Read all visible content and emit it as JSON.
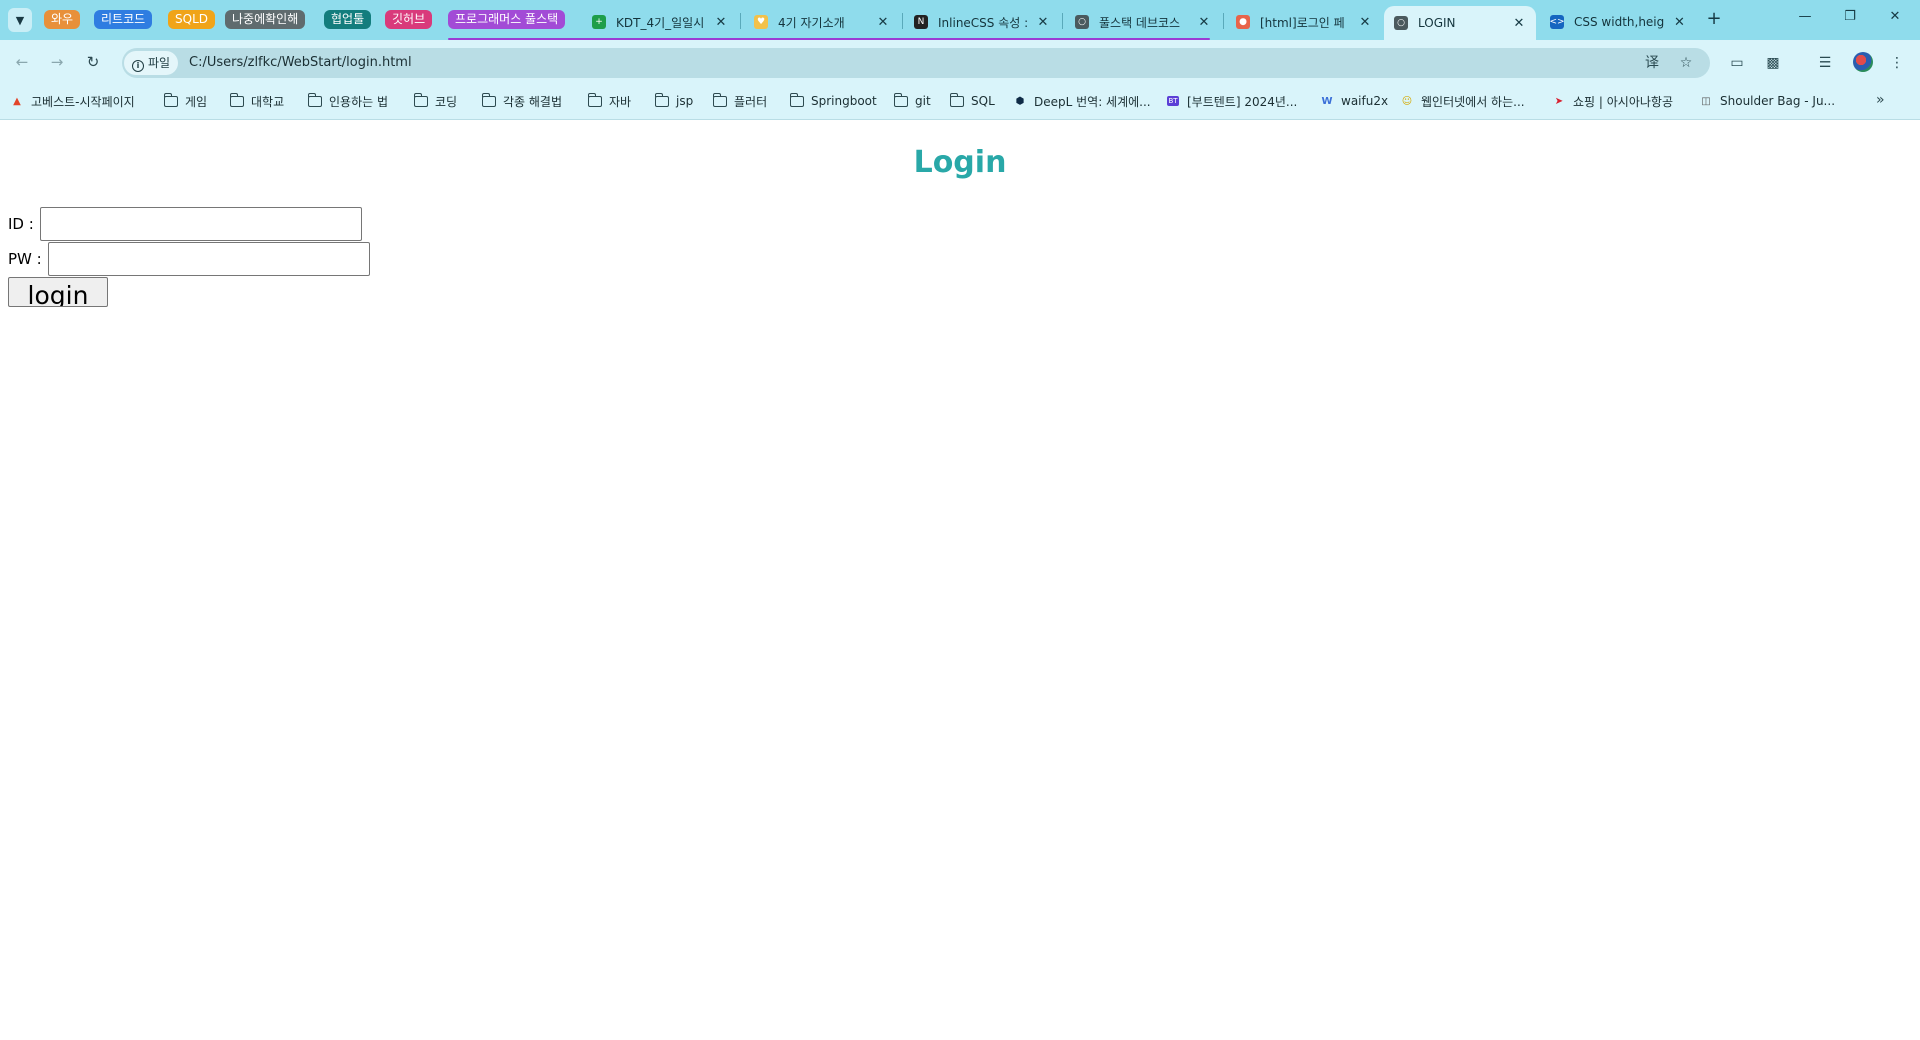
{
  "browser": {
    "tab_groups": [
      {
        "label": "와우",
        "color": "#e8903a"
      },
      {
        "label": "리트코드",
        "color": "#2f7de1"
      },
      {
        "label": "SQLD",
        "color": "#f0a418"
      },
      {
        "label": "나중에확인해",
        "color": "#5f6b6e"
      },
      {
        "label": "협업툴",
        "color": "#137d7d"
      },
      {
        "label": "깃허브",
        "color": "#d93a7b"
      },
      {
        "label": "프로그래머스 풀스택",
        "color": "#a24bd6"
      }
    ],
    "tabs": [
      {
        "title": "KDT_4기_일일시",
        "favicon": "sheets-icon",
        "favicon_color": "#1e9e4a",
        "active": false
      },
      {
        "title": "4기 자기소개",
        "favicon": "heart-icon",
        "favicon_color": "#f2c14a",
        "active": false
      },
      {
        "title": "InlineCSS 속성 :",
        "favicon": "notion-icon",
        "favicon_color": "#222222",
        "active": false
      },
      {
        "title": "풀스택 데브코스",
        "favicon": "globe-icon",
        "favicon_color": "#4a5a5e",
        "active": false
      },
      {
        "title": "[html]로그인 페",
        "favicon": "tistory-icon",
        "favicon_color": "#e8644a",
        "active": false
      },
      {
        "title": "LOGIN",
        "favicon": "globe-icon",
        "favicon_color": "#4a5a5e",
        "active": true
      },
      {
        "title": "CSS width,heigh",
        "favicon": "code-icon",
        "favicon_color": "#1565c0",
        "active": false
      }
    ],
    "address": {
      "scheme_label": "파일",
      "url": "C:/Users/zlfkc/WebStart/login.html"
    },
    "bookmarks": [
      {
        "label": "고베스트-시작페이지",
        "icon": "fire-icon"
      },
      {
        "label": "게임",
        "icon": "folder-icon"
      },
      {
        "label": "대학교",
        "icon": "folder-icon"
      },
      {
        "label": "인용하는 법",
        "icon": "folder-icon"
      },
      {
        "label": "코딩",
        "icon": "folder-icon"
      },
      {
        "label": "각종 해결법",
        "icon": "folder-icon"
      },
      {
        "label": "자바",
        "icon": "folder-icon"
      },
      {
        "label": "jsp",
        "icon": "folder-icon"
      },
      {
        "label": "플러터",
        "icon": "folder-icon"
      },
      {
        "label": "Springboot",
        "icon": "folder-icon"
      },
      {
        "label": "git",
        "icon": "folder-icon"
      },
      {
        "label": "SQL",
        "icon": "folder-icon"
      },
      {
        "label": "DeepL 번역: 세계에...",
        "icon": "deepl-icon"
      },
      {
        "label": "[부트텐트] 2024년...",
        "icon": "bt-icon"
      },
      {
        "label": "waifu2x",
        "icon": "w-icon"
      },
      {
        "label": "웹인터넷에서 하는...",
        "icon": "smile-icon"
      },
      {
        "label": "쇼핑 | 아시아나항공",
        "icon": "plane-icon"
      },
      {
        "label": "Shoulder Bag - Ju...",
        "icon": "bag-icon"
      }
    ]
  },
  "page": {
    "title": "Login",
    "id_label": "ID :",
    "pw_label": "PW :",
    "id_value": "",
    "pw_value": "",
    "submit_label": "login"
  }
}
